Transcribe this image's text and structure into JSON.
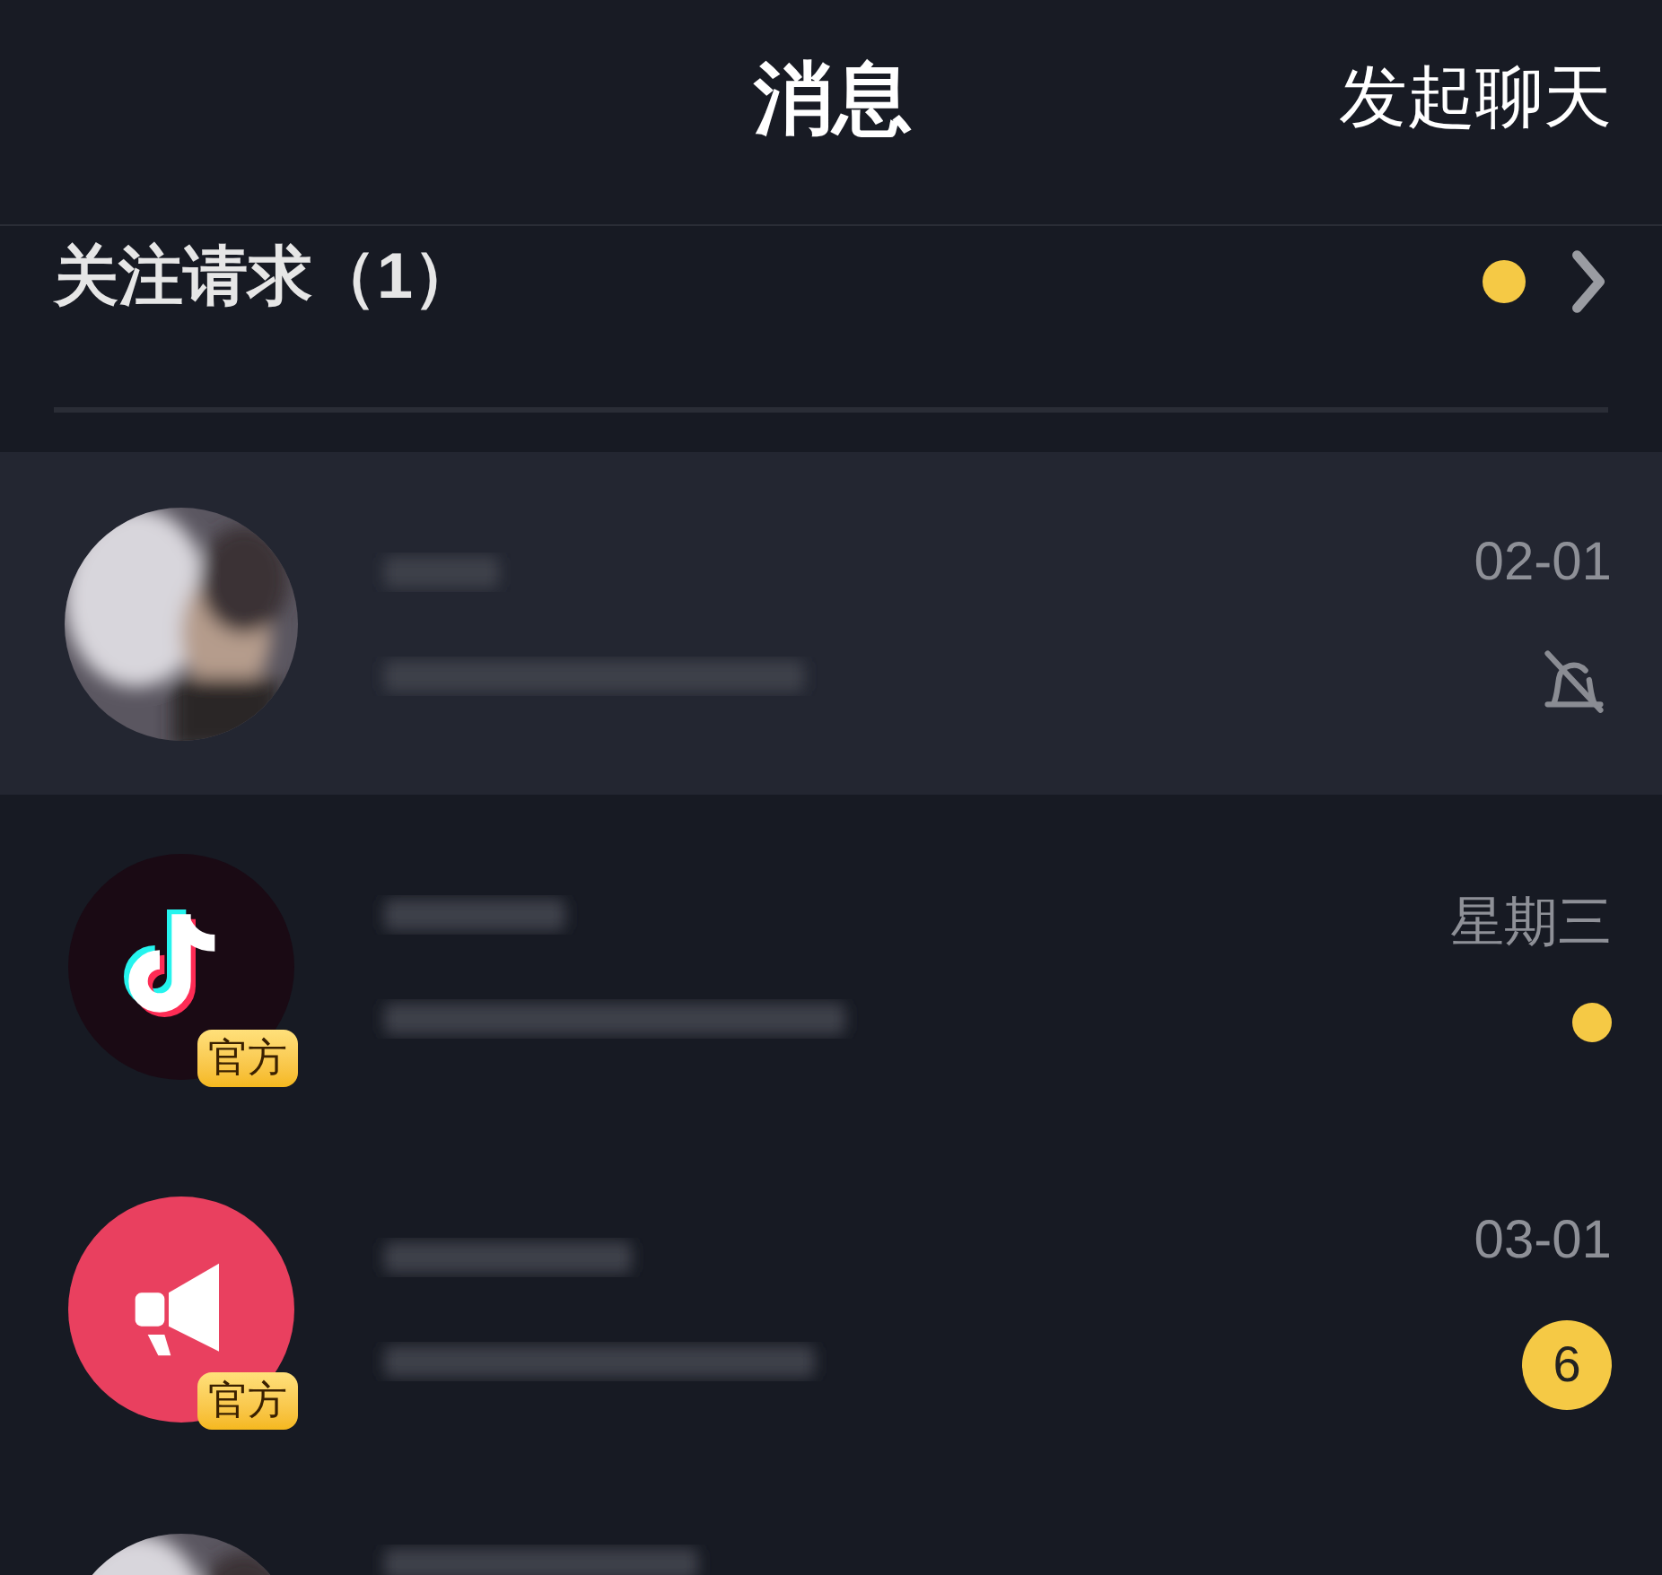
{
  "header": {
    "title": "消息",
    "action": "发起聊天"
  },
  "follow_requests": {
    "label": "关注请求（1）",
    "unread": true
  },
  "conversations": [
    {
      "official": false,
      "selected": true,
      "time": "02-01",
      "indicator": {
        "kind": "muted"
      }
    },
    {
      "avatar": {
        "kind": "note-logo"
      },
      "official": true,
      "official_label": "官方",
      "selected": false,
      "time": "星期三",
      "indicator": {
        "kind": "dot"
      }
    },
    {
      "avatar": {
        "kind": "megaphone"
      },
      "official": true,
      "official_label": "官方",
      "selected": false,
      "time": "03-01",
      "indicator": {
        "kind": "count",
        "count": "6"
      }
    },
    {
      "official": false,
      "selected": false
    }
  ]
}
